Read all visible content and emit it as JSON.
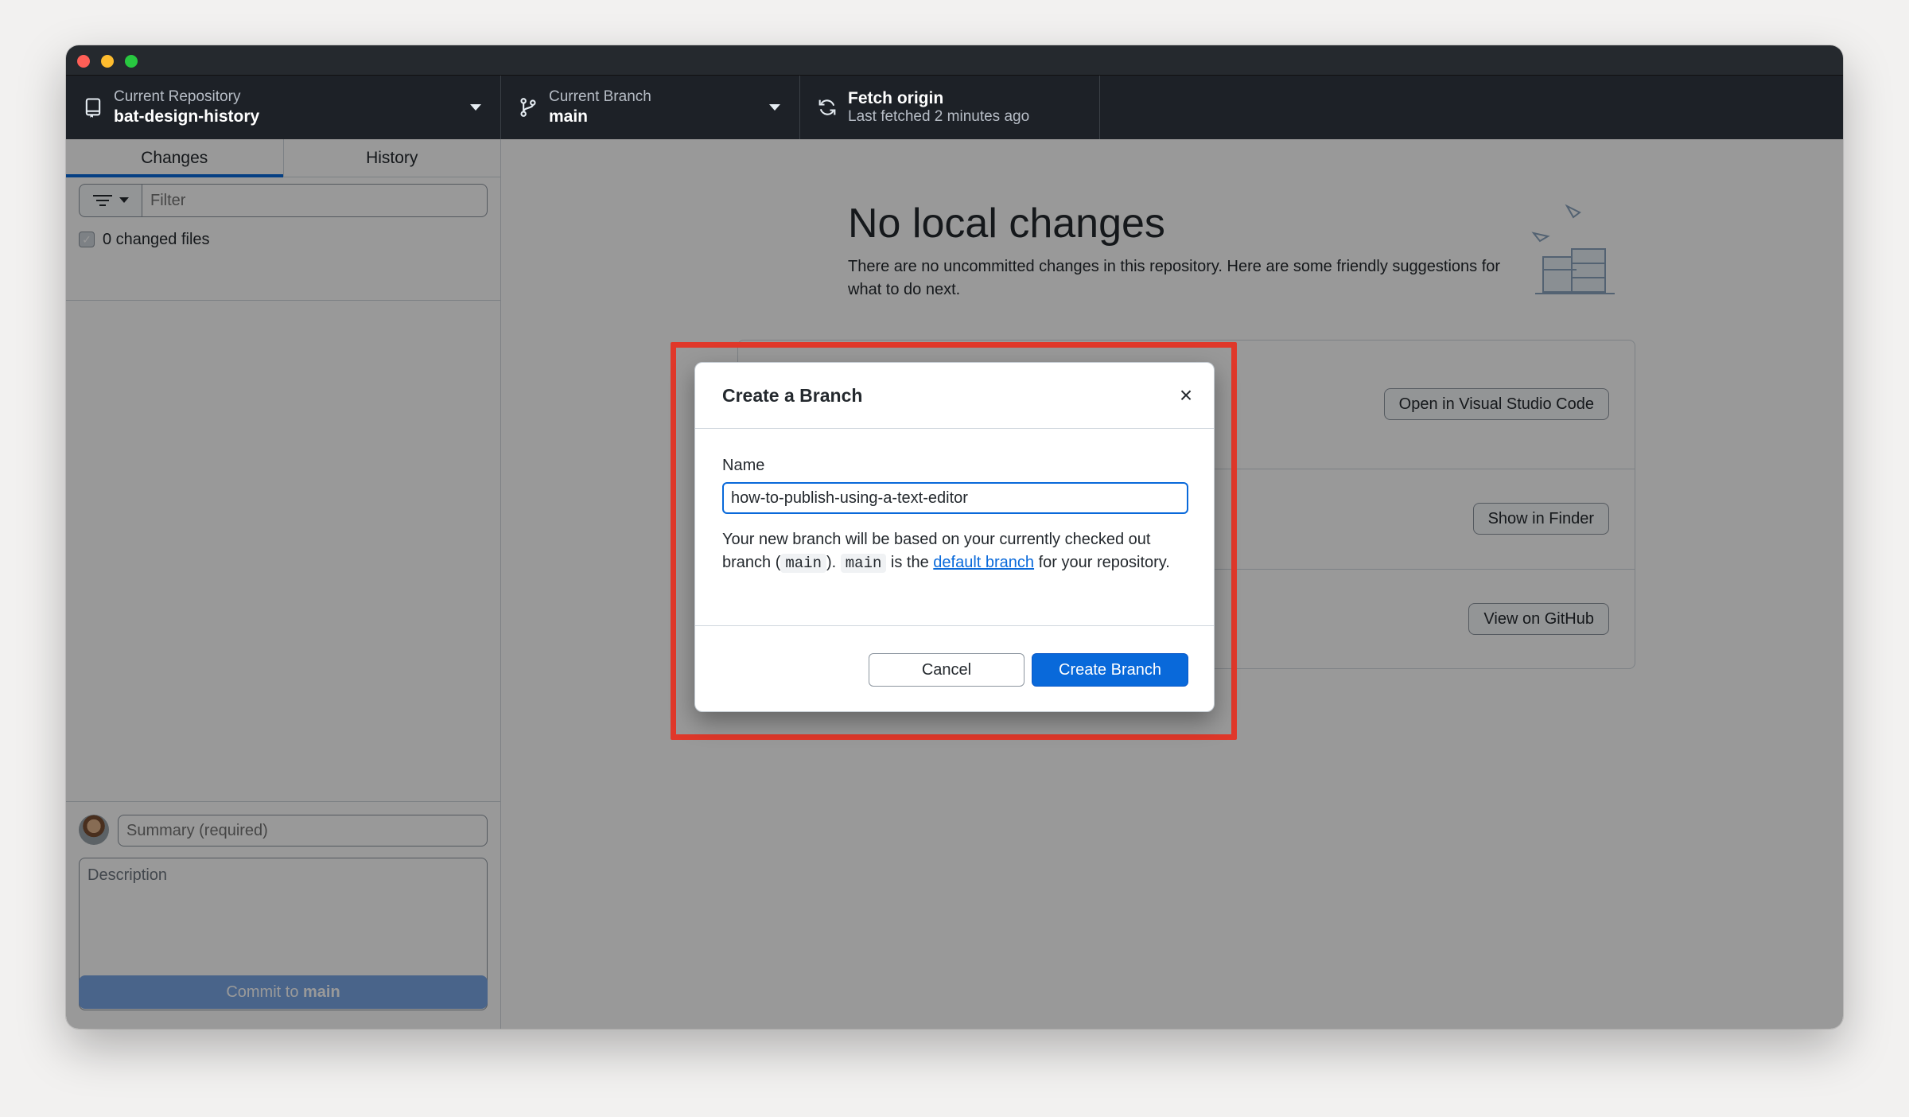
{
  "toolbar": {
    "repo": {
      "label": "Current Repository",
      "value": "bat-design-history"
    },
    "branch": {
      "label": "Current Branch",
      "value": "main"
    },
    "fetch": {
      "label": "Fetch origin",
      "sub": "Last fetched 2 minutes ago"
    }
  },
  "sidebar": {
    "tabs": [
      {
        "label": "Changes"
      },
      {
        "label": "History"
      }
    ],
    "filter_placeholder": "Filter",
    "changed_files": "0 changed files",
    "summary_placeholder": "Summary (required)",
    "description_placeholder": "Description",
    "commit_prefix": "Commit to ",
    "commit_branch": "main"
  },
  "main": {
    "headline": "No local changes",
    "subtext": "There are no uncommitted changes in this repository. Here are some friendly suggestions for what to do next.",
    "suggestions": [
      {
        "button": "Open in Visual Studio Code"
      },
      {
        "button": "Show in Finder"
      },
      {
        "button": "View on GitHub"
      }
    ]
  },
  "dialog": {
    "title": "Create a Branch",
    "close_symbol": "×",
    "name_label": "Name",
    "name_value": "how-to-publish-using-a-text-editor",
    "help_part1": "Your new branch will be based on your currently checked out branch (",
    "help_code1": "main",
    "help_part2": "). ",
    "help_code2": "main",
    "help_part3": " is the ",
    "help_link": "default branch",
    "help_part4": " for your repository.",
    "cancel_label": "Cancel",
    "create_label": "Create Branch"
  },
  "colors": {
    "accent": "#0969da",
    "highlight": "#e0382a",
    "toolbar_bg": "#1d2127"
  }
}
